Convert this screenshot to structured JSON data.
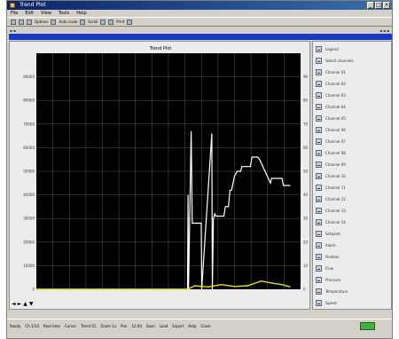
{
  "window": {
    "title": "Trend Plot",
    "subtitle": "",
    "menu": [
      "File",
      "Edit",
      "View",
      "Tools",
      "Help"
    ],
    "toolbar_labels": [
      "Options",
      "Auto scale",
      "Scroll",
      "Print"
    ],
    "status": [
      "Ready",
      "Ch 1/14",
      "Real time",
      "Cursor",
      "Trend 01",
      "Zoom 1x",
      "Pan",
      "12:00",
      "Save",
      "Load",
      "Export",
      "Help",
      "Close"
    ],
    "nav_buttons": [
      "◄",
      "►",
      "▲",
      "▼"
    ]
  },
  "chart_data": {
    "type": "line",
    "title": "Trend Plot",
    "xlabel": "",
    "ylabel": "",
    "xlim": [
      0,
      100
    ],
    "ylim": [
      0,
      100
    ],
    "grid": true,
    "background": "#000000",
    "left_ticks": [
      "90000",
      "80000",
      "70000",
      "60000",
      "50000",
      "40000",
      "30000",
      "20000",
      "10000",
      "0"
    ],
    "right_ticks": [
      "90",
      "80",
      "70",
      "60",
      "50",
      "40",
      "30",
      "20",
      "10",
      "0"
    ],
    "x_tick_labels": [],
    "x_end_label": "",
    "series": [
      {
        "color": "#ffffff",
        "x": [
          0,
          57.2,
          57.4,
          57.6,
          58.6,
          59.0,
          62.4,
          62.6,
          66.4,
          66.6,
          67.0,
          67.5,
          67.9,
          71.0,
          71.5,
          72.7,
          73.3,
          73.9,
          75.0,
          76.0,
          77.3,
          77.8,
          81.0,
          81.6,
          83.8,
          84.5,
          88.6,
          89.0,
          93.0,
          93.5,
          96.1
        ],
        "y": [
          0,
          0,
          40,
          0,
          67,
          28,
          28,
          0,
          66,
          0,
          30,
          32,
          31,
          31,
          35,
          35,
          42,
          42,
          48,
          50,
          50,
          52,
          52,
          56,
          56,
          55,
          45,
          47,
          47,
          44,
          44
        ]
      },
      {
        "color": "#e0e020",
        "x": [
          0,
          57.2,
          60,
          65,
          70,
          75,
          80,
          85,
          90,
          93,
          96.1
        ],
        "y": [
          0,
          0,
          1.5,
          1.0,
          2.0,
          1.2,
          1.5,
          3.5,
          2.5,
          2.0,
          1.0
        ]
      }
    ]
  },
  "legend_items": [
    "Legend",
    "Select channels",
    "Channel 01",
    "Channel 02",
    "Channel 03",
    "Channel 04",
    "Channel 05",
    "Channel 06",
    "Channel 07",
    "Channel 08",
    "Channel 09",
    "Channel 10",
    "Channel 11",
    "Channel 12",
    "Channel 13",
    "Channel 14",
    "Setpoint",
    "Alarm",
    "Position",
    "Flow",
    "Pressure",
    "Temperature",
    "Speed"
  ],
  "colors": {
    "title_bar": "#0a246a",
    "subtitle_bar": "#1838c8",
    "status_ok": "#40b040"
  }
}
